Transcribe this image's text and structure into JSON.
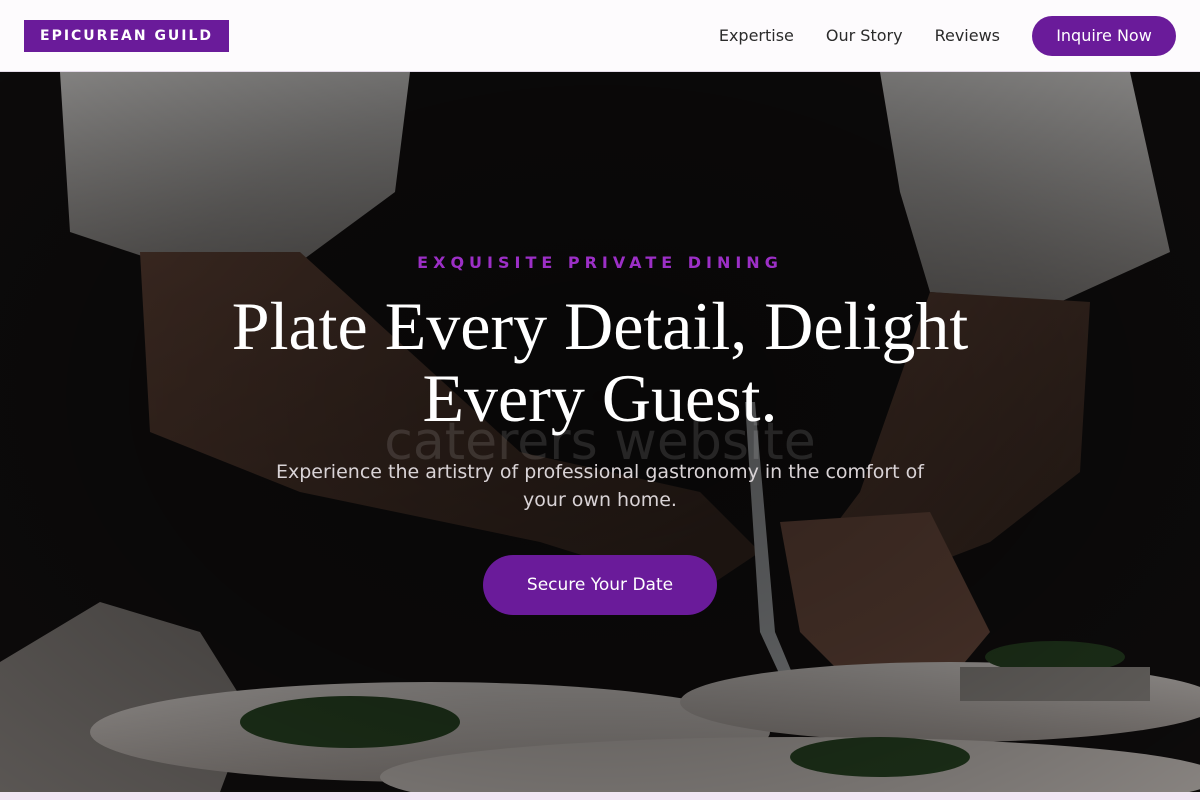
{
  "brand": {
    "name": "EPICUREAN GUILD",
    "accent": "#6a1b9a"
  },
  "nav": {
    "links": [
      "Expertise",
      "Our Story",
      "Reviews"
    ],
    "cta_label": "Inquire Now"
  },
  "hero": {
    "eyebrow": "EXQUISITE PRIVATE DINING",
    "headline": "Plate Every Detail, Delight Every Guest.",
    "background_watermark": "caterers website",
    "subtitle": "Experience the artistry of professional gastronomy in the comfort of your own home.",
    "cta_label": "Secure Your Date",
    "image_subject": "chef-plating-dishes-photo"
  }
}
